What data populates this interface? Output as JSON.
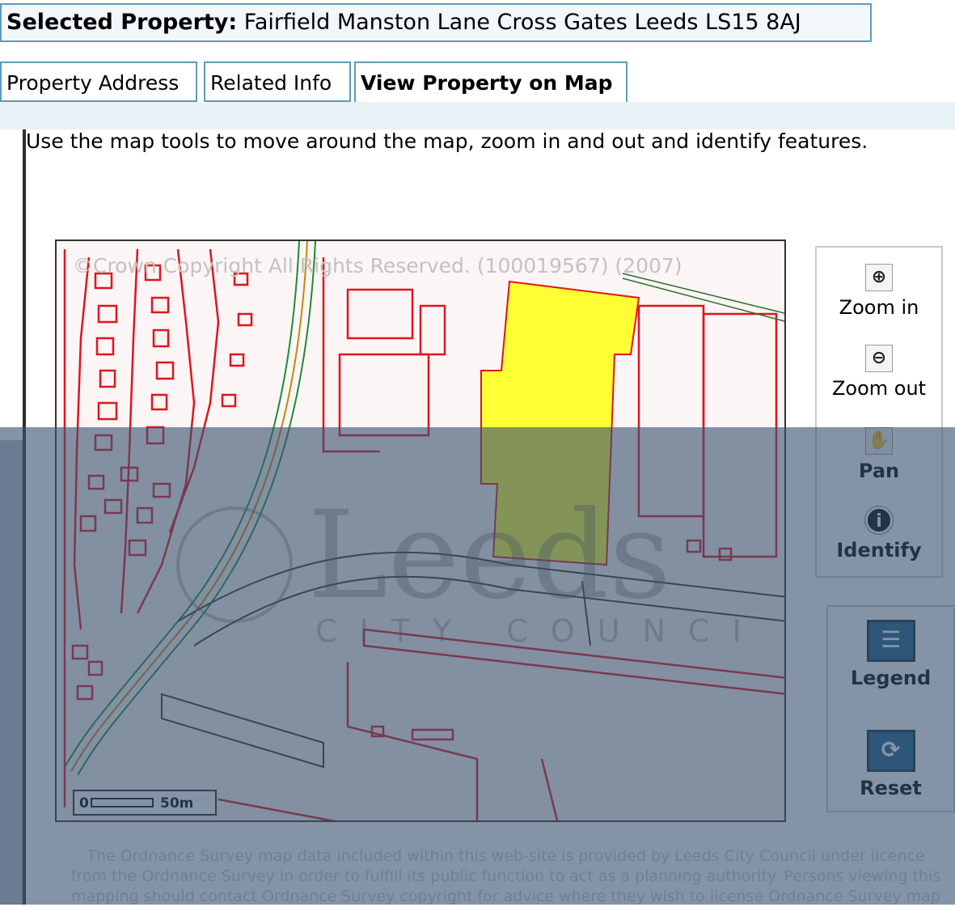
{
  "header": {
    "selected_label": "Selected Property:",
    "selected_value": "Fairfield Manston Lane Cross Gates Leeds LS15 8AJ"
  },
  "tabs": [
    {
      "label": "Property Address",
      "active": false
    },
    {
      "label": "Related Info",
      "active": false
    },
    {
      "label": "View Property on Map",
      "active": true
    }
  ],
  "instructions": "Use the map tools to move around the map, zoom in and out and identify features.",
  "map": {
    "copyright": "©Crown Copyright All Rights Reserved. (100019567) (2007)",
    "scale": {
      "start": "0",
      "end": "50m"
    },
    "watermark": {
      "name": "Leeds",
      "subtitle": "CITY COUNCIL"
    },
    "highlight_color": "#ffff33",
    "building_color": "#e0141e"
  },
  "tools": [
    {
      "label": "Zoom in",
      "icon": "zoom-in-icon"
    },
    {
      "label": "Zoom out",
      "icon": "zoom-out-icon"
    },
    {
      "label": "Pan",
      "icon": "pan-hand-icon"
    },
    {
      "label": "Identify",
      "icon": "info-icon"
    }
  ],
  "actions": [
    {
      "label": "Legend",
      "icon": "legend-icon"
    },
    {
      "label": "Reset",
      "icon": "reset-icon"
    }
  ],
  "disclaimer": [
    "The Ordnance Survey map data included within this web-site is provided by Leeds City Council under licence",
    "from the Ordnance Survey in order to fulfill its public function to act as a planning authority. Persons viewing this",
    "mapping should contact Ordnance Survey copyright for advice where they wish to license Ordnance Survey map"
  ]
}
